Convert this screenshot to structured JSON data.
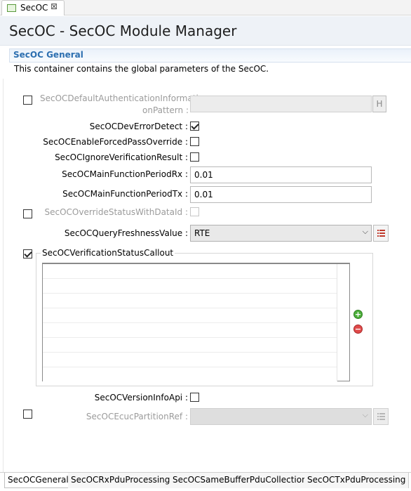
{
  "editor_tab": {
    "title": "SecOC",
    "close_symbol": "⊠"
  },
  "page_title": "SecOC - SecOC Module Manager",
  "section": {
    "title": "SecOC General",
    "description": "This container contains the global parameters of the SecOC."
  },
  "fields": {
    "auth_pattern": {
      "label_line1": "SecOCDefaultAuthenticationInformati",
      "label_line2": "onPattern :",
      "value": "",
      "button_label": "H",
      "enabled": false
    },
    "dev_error_detect": {
      "label": "SecOCDevErrorDetect :",
      "checked": true
    },
    "forced_pass_override": {
      "label": "SecOCEnableForcedPassOverride :",
      "checked": false
    },
    "ignore_verification": {
      "label": "SecOCIgnoreVerificationResult :",
      "checked": false
    },
    "main_period_rx": {
      "label": "SecOCMainFunctionPeriodRx :",
      "value": "0.01"
    },
    "main_period_tx": {
      "label": "SecOCMainFunctionPeriodTx :",
      "value": "0.01"
    },
    "override_status": {
      "label": "SecOCOverrideStatusWithDataId :",
      "checked": false,
      "enabled": false
    },
    "query_freshness": {
      "label": "SecOCQueryFreshnessValue :",
      "value": "RTE"
    },
    "verification_callout": {
      "label": "SecOCVerificationStatusCallout",
      "checked": true
    },
    "version_info_api": {
      "label": "SecOCVersionInfoApi :",
      "checked": false
    },
    "ecuc_partition_ref": {
      "label": "SecOCEcucPartitionRef :",
      "value": "",
      "enabled": false
    }
  },
  "icons": {
    "add": "+",
    "remove": "−",
    "dropdown": "⌵"
  },
  "bottom_tabs": [
    {
      "label": "SecOCGeneral",
      "active": true
    },
    {
      "label": "SecOCRxPduProcessing",
      "active": false
    },
    {
      "label": "SecOCSameBufferPduCollection",
      "active": false
    },
    {
      "label": "SecOCTxPduProcessing",
      "active": false
    }
  ],
  "colors": {
    "section_title": "#2d6fb0",
    "add_green": "#4caf3a",
    "remove_red": "#e04a4a"
  }
}
